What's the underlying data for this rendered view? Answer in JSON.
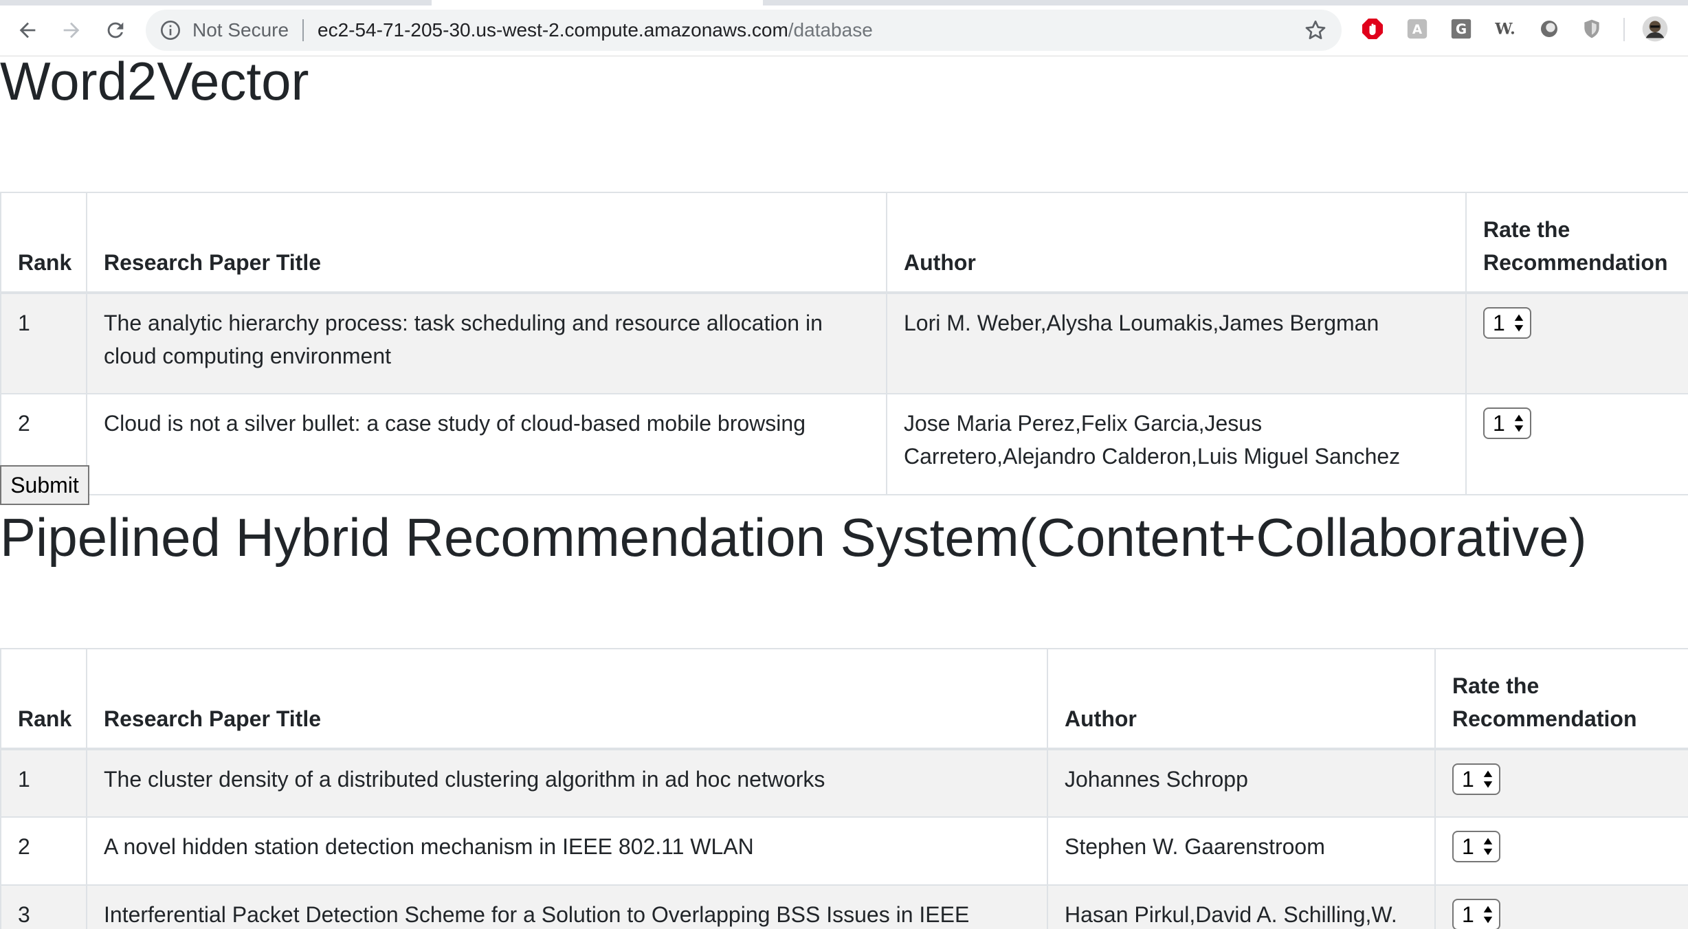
{
  "browser": {
    "security_label": "Not Secure",
    "url_host": "ec2-54-71-205-30.us-west-2.compute.amazonaws.com",
    "url_path": "/database",
    "extensions": [
      "adblock-icon",
      "translate-icon",
      "grammarly-icon",
      "wikiwand-icon",
      "circle-extension-icon",
      "shield-extension-icon"
    ]
  },
  "sections": [
    {
      "title": "Word2Vector",
      "headers": {
        "rank": "Rank",
        "title": "Research Paper Title",
        "author": "Author",
        "rate": "Rate the Recommendation"
      },
      "rows": [
        {
          "rank": "1",
          "title": "The analytic hierarchy process: task scheduling and resource allocation in cloud computing environment",
          "author": "Lori M. Weber,Alysha Loumakis,James Bergman",
          "rating": "1"
        },
        {
          "rank": "2",
          "title": "Cloud is not a silver bullet: a case study of cloud-based mobile browsing",
          "author": "Jose Maria Perez,Felix Garcia,Jesus Carretero,Alejandro Calderon,Luis Miguel Sanchez",
          "rating": "1"
        }
      ],
      "submit_label": "Submit"
    },
    {
      "title": "Pipelined Hybrid Recommendation System(Content+Collaborative)",
      "headers": {
        "rank": "Rank",
        "title": "Research Paper Title",
        "author": "Author",
        "rate": "Rate the Recommendation"
      },
      "rows": [
        {
          "rank": "1",
          "title": "The cluster density of a distributed clustering algorithm in ad hoc networks",
          "author": "Johannes Schropp",
          "rating": "1"
        },
        {
          "rank": "2",
          "title": "A novel hidden station detection mechanism in IEEE 802.11 WLAN",
          "author": "Stephen W. Gaarenstroom",
          "rating": "1"
        },
        {
          "rank": "3",
          "title": "Interferential Packet Detection Scheme for a Solution to Overlapping BSS Issues in IEEE",
          "author": "Hasan Pirkul,David A. Schilling,W.",
          "rating": "1"
        }
      ]
    }
  ]
}
